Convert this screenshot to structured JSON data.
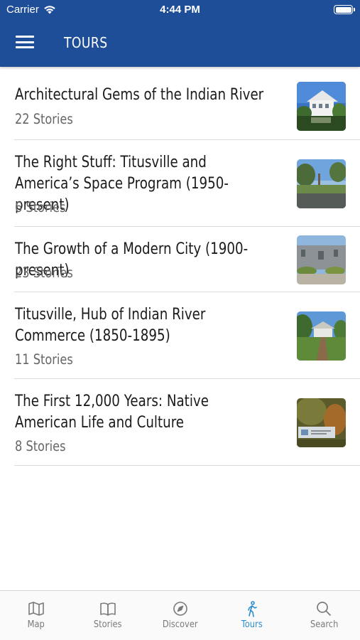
{
  "status_bar": {
    "carrier": "Carrier",
    "time": "4:44 PM"
  },
  "header": {
    "title": "TOURS"
  },
  "tours": [
    {
      "name": "Architectural Gems of the Indian River",
      "count": "22 Stories"
    },
    {
      "name": "The Right Stuff: Titusville and America’s Space Program (1950-present)",
      "count": "6 Stories"
    },
    {
      "name": "The Growth of a Modern City (1900-present)",
      "count": "23 Stories"
    },
    {
      "name": "Titusville, Hub of Indian River Commerce (1850-1895)",
      "count": "11 Stories"
    },
    {
      "name": "The First 12,000 Years: Native American Life and Culture",
      "count": "8 Stories"
    }
  ],
  "tab_bar": {
    "items": [
      {
        "label": "Map",
        "icon": "map-icon"
      },
      {
        "label": "Stories",
        "icon": "book-icon"
      },
      {
        "label": "Discover",
        "icon": "compass-icon"
      },
      {
        "label": "Tours",
        "icon": "walking-person-icon"
      },
      {
        "label": "Search",
        "icon": "search-icon"
      }
    ],
    "active": "Tours"
  },
  "colors": {
    "header": "#1f4e99",
    "active_tab": "#2a8ccf",
    "inactive_tab": "#7a7a7a"
  }
}
